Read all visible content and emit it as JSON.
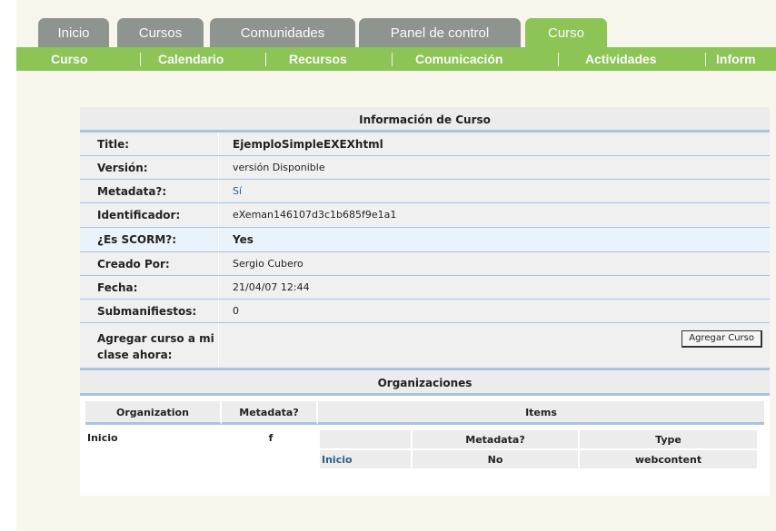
{
  "tabs": [
    {
      "label": "Inicio",
      "active": false
    },
    {
      "label": "Cursos",
      "active": false
    },
    {
      "label": "Comunidades",
      "active": false
    },
    {
      "label": "Panel de control",
      "active": false
    },
    {
      "label": "Curso",
      "active": true
    }
  ],
  "subnav": [
    "Curso",
    "Calendario",
    "Recursos",
    "Comunicación",
    "Actividades",
    "Inform"
  ],
  "info": {
    "heading": "Información de Curso",
    "rows": [
      {
        "key": "Title:",
        "value": "EjemploSimpleEXEXhtml"
      },
      {
        "key": "Versión:",
        "value": "versión Disponible"
      },
      {
        "key": "Metadata?:",
        "value": "Sí"
      },
      {
        "key": "Identificador:",
        "value": "eXeman146107d3c1b685f9e1a1"
      },
      {
        "key": "¿Es SCORM?:",
        "value": "Yes"
      },
      {
        "key": "Creado Por:",
        "value": "Sergio Cubero"
      },
      {
        "key": "Fecha:",
        "value": "21/04/07 12:44"
      },
      {
        "key": "Submanifiestos:",
        "value": "0"
      },
      {
        "key": "Agregar curso a mi clase ahora:",
        "value": ""
      }
    ],
    "add_button": "Agregar Curso"
  },
  "orgs": {
    "heading": "Organizaciones",
    "col_organization": "Organization",
    "col_metadata": "Metadata?",
    "col_items": "Items",
    "org_name": "Inicio",
    "org_metadata": "f",
    "items_col_metadata": "Metadata?",
    "items_col_type": "Type",
    "item": {
      "name": "Inicio",
      "metadata": "No",
      "type": "webcontent"
    }
  },
  "colors": {
    "tab_inactive": "#8e948e",
    "tab_active": "#8dc456",
    "subnav": "#8dc456",
    "rule_blue": "#a8c3df"
  }
}
